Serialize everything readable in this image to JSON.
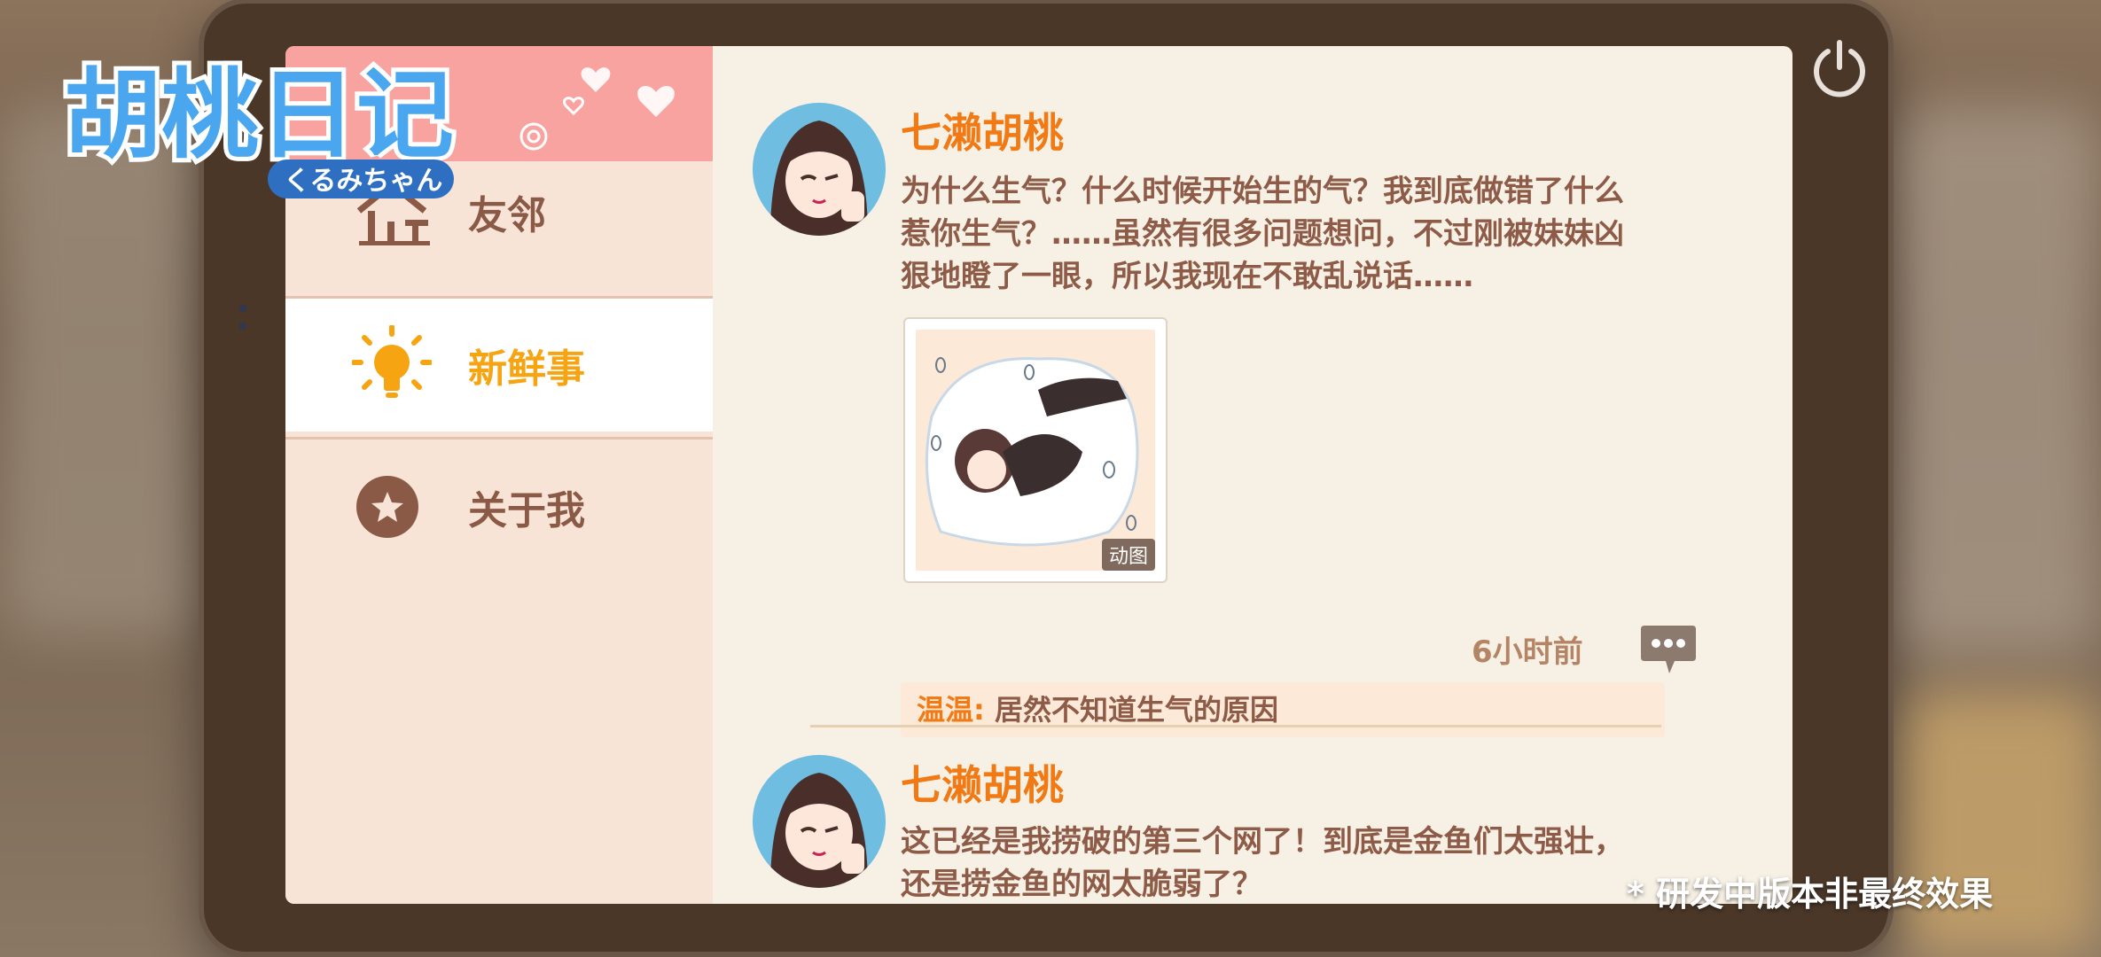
{
  "app": {
    "logo_title": "胡桃日记",
    "logo_subtitle": "くるみちゃん",
    "watermark": "* 研发中版本非最终效果"
  },
  "sidebar": {
    "items": [
      {
        "label": "友邻",
        "icon": "house-icon",
        "active": false
      },
      {
        "label": "新鲜事",
        "icon": "lightbulb-icon",
        "active": true
      },
      {
        "label": "关于我",
        "icon": "star-badge-icon",
        "active": false
      }
    ]
  },
  "feed": {
    "posts": [
      {
        "author": "七濑胡桃",
        "text_lines": [
          "为什么生气？什么时候开始生的气？我到底做错了什么",
          "惹你生气？……虽然有很多问题想问，不过刚被妹妹凶",
          "狠地瞪了一眼，所以我现在不敢乱说话……"
        ],
        "image_badge": "动图",
        "time": "6小时前",
        "comment": {
          "user": "温温:",
          "text": " 居然不知道生气的原因"
        }
      },
      {
        "author": "七濑胡桃",
        "text_lines": [
          "这已经是我捞破的第三个网了！到底是金鱼们太强壮，",
          "还是捞金鱼的网太脆弱了？"
        ]
      }
    ]
  },
  "colors": {
    "accent_orange": "#f17a14",
    "active_yellow": "#f6a411",
    "text_brown": "#8d5b47",
    "sidebar_bg": "#f8e4d6",
    "sidebar_header_pink": "#f9a3a1",
    "screen_bg": "#f7f0e4",
    "tablet_frame": "#4a3728"
  }
}
